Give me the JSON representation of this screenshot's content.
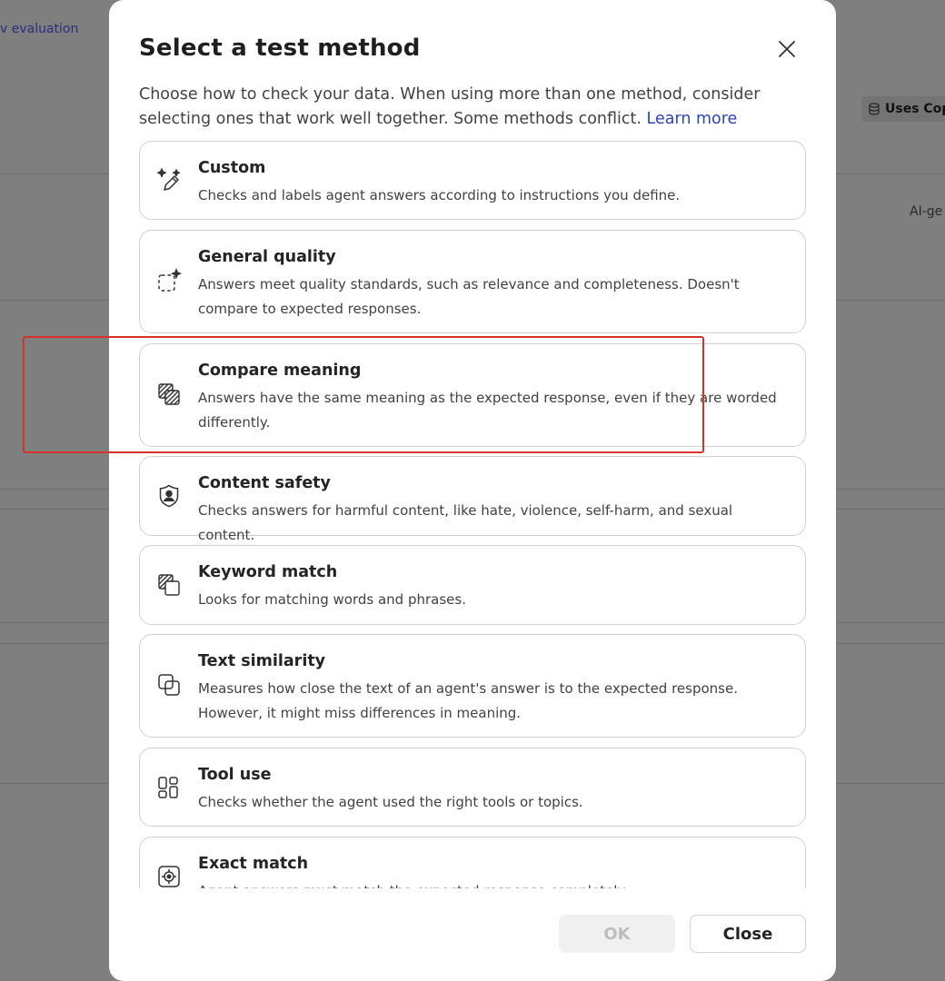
{
  "background": {
    "link_text": "v evaluation",
    "badge_label": "Uses Cop",
    "column_text": "AI-ge"
  },
  "dialog": {
    "title": "Select a test method",
    "description": "Choose how to check your data. When using more than one method, consider selecting ones that work well together. Some methods conflict.",
    "learn_more": "Learn more",
    "methods": [
      {
        "name": "Custom",
        "description": "Checks and labels agent answers according to instructions you define.",
        "icon": "sparkle-pen-icon"
      },
      {
        "name": "General quality",
        "description": "Answers meet quality standards, such as relevance and completeness. Doesn't compare to expected responses.",
        "icon": "dashed-square-sparkle-icon"
      },
      {
        "name": "Compare meaning",
        "description": "Answers have the same meaning as the expected response, even if they are worded differently.",
        "icon": "hatched-squares-icon"
      },
      {
        "name": "Content safety",
        "description": "Checks answers for harmful content, like hate, violence, self-harm, and sexual content.",
        "icon": "shield-person-icon"
      },
      {
        "name": "Keyword match",
        "description": "Looks for matching words and phrases.",
        "icon": "overlapping-squares-icon"
      },
      {
        "name": "Text similarity",
        "description": "Measures how close the text of an agent's answer is to the expected response. However, it might miss differences in meaning.",
        "icon": "copy-squares-icon"
      },
      {
        "name": "Tool use",
        "description": "Checks whether the agent used the right tools or topics.",
        "icon": "apps-layout-icon"
      },
      {
        "name": "Exact match",
        "description": "Agent answers must match the expected response completely.",
        "icon": "target-square-icon"
      }
    ],
    "ok_label": "OK",
    "close_label": "Close"
  },
  "colors": {
    "accent_link": "#2f43bb",
    "highlight_border": "#d6312b",
    "overlay": "#7f7f7f"
  }
}
